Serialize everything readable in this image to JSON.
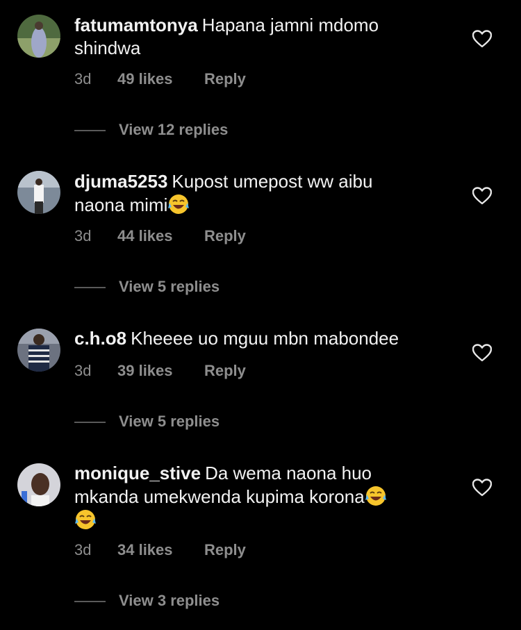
{
  "comments": [
    {
      "username": "fatumamtonya",
      "text": "Hapana jamni mdomo shindwa",
      "time": "3d",
      "likes": "49 likes",
      "reply_label": "Reply",
      "view_replies": "View 12 replies",
      "avatar_color": "#5b6b4a"
    },
    {
      "username": "djuma5253",
      "text": "Kupost umepost ww aibu naona mimi",
      "emoji": [
        "face-with-tears-of-joy"
      ],
      "time": "3d",
      "likes": "44 likes",
      "reply_label": "Reply",
      "view_replies": "View 5 replies",
      "avatar_color": "#6a7686"
    },
    {
      "username": "c.h.o8",
      "text": "Kheeee uo mguu mbn mabondee",
      "time": "3d",
      "likes": "39 likes",
      "reply_label": "Reply",
      "view_replies": "View 5 replies",
      "avatar_color": "#3a4a62"
    },
    {
      "username": "monique_stive",
      "text": "Da wema naona huo mkanda umekwenda kupima korona",
      "emoji": [
        "face-with-tears-of-joy",
        "face-with-tears-of-joy"
      ],
      "time": "3d",
      "likes": "34 likes",
      "reply_label": "Reply",
      "view_replies": "View 3 replies",
      "avatar_color": "#c9c9cf"
    }
  ],
  "colors": {
    "background": "#000000",
    "text": "#f2f2f2",
    "muted": "#8e8e8e"
  }
}
